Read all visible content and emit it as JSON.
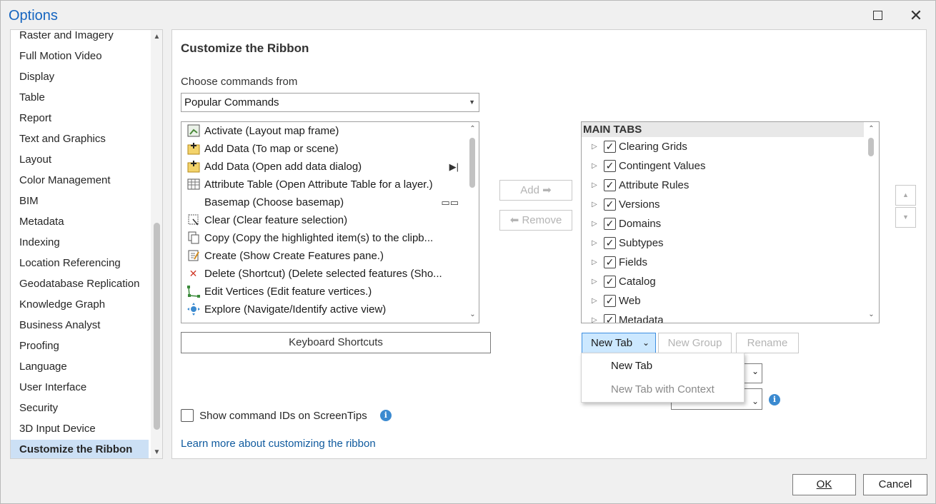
{
  "window": {
    "title": "Options"
  },
  "sidebar": {
    "items": [
      {
        "label": "Raster and Imagery"
      },
      {
        "label": "Full Motion Video"
      },
      {
        "label": "Display"
      },
      {
        "label": "Table"
      },
      {
        "label": "Report"
      },
      {
        "label": "Text and Graphics"
      },
      {
        "label": "Layout"
      },
      {
        "label": "Color Management"
      },
      {
        "label": "BIM"
      },
      {
        "label": "Metadata"
      },
      {
        "label": "Indexing"
      },
      {
        "label": "Location Referencing"
      },
      {
        "label": "Geodatabase Replication"
      },
      {
        "label": "Knowledge Graph"
      },
      {
        "label": "Business Analyst"
      },
      {
        "label": "Proofing"
      },
      {
        "label": "Language"
      },
      {
        "label": "User Interface"
      },
      {
        "label": "Security"
      },
      {
        "label": "3D Input Device"
      },
      {
        "label": "Customize the Ribbon"
      }
    ],
    "selected": "Customize the Ribbon"
  },
  "main": {
    "title": "Customize the Ribbon",
    "choose_label": "Choose commands from",
    "choose_value": "Popular Commands",
    "commands": [
      {
        "label": "Activate (Layout map frame)",
        "icon": "activate-icon"
      },
      {
        "label": "Add Data (To map or scene)",
        "icon": "add-data-icon"
      },
      {
        "label": "Add Data (Open add data dialog)",
        "icon": "add-data-icon",
        "right": "▶|"
      },
      {
        "label": "Attribute Table (Open Attribute Table for a layer.)",
        "icon": "table-icon"
      },
      {
        "label": "Basemap (Choose basemap)",
        "icon": "",
        "right": "▭▭"
      },
      {
        "label": "Clear (Clear feature selection)",
        "icon": "clear-icon"
      },
      {
        "label": "Copy (Copy the highlighted item(s) to the clipb...",
        "icon": "copy-icon"
      },
      {
        "label": "Create (Show Create Features pane.)",
        "icon": "create-icon"
      },
      {
        "label": "Delete (Shortcut) (Delete selected features (Sho...",
        "icon": "delete-icon"
      },
      {
        "label": "Edit Vertices (Edit feature vertices.)",
        "icon": "edit-vertices-icon"
      },
      {
        "label": "Explore (Navigate/Identify active view)",
        "icon": "explore-icon"
      }
    ],
    "keyboard_shortcuts": "Keyboard Shortcuts",
    "add_label": "Add",
    "remove_label": "Remove",
    "main_tabs_header": "MAIN TABS",
    "tabs": [
      {
        "label": "Clearing Grids",
        "checked": true
      },
      {
        "label": "Contingent Values",
        "checked": true
      },
      {
        "label": "Attribute Rules",
        "checked": true
      },
      {
        "label": "Versions",
        "checked": true
      },
      {
        "label": "Domains",
        "checked": true
      },
      {
        "label": "Subtypes",
        "checked": true
      },
      {
        "label": "Fields",
        "checked": true
      },
      {
        "label": "Catalog",
        "checked": true
      },
      {
        "label": "Web",
        "checked": true
      },
      {
        "label": "Metadata",
        "checked": true
      }
    ],
    "new_tab": "New Tab",
    "new_group": "New Group",
    "rename": "Rename",
    "show_ids": "Show command IDs on ScreenTips",
    "learn_more": "Learn more about customizing the ribbon",
    "dropdown_menu": [
      {
        "label": "New Tab",
        "enabled": true
      },
      {
        "label": "New Tab with Context",
        "enabled": false
      }
    ]
  },
  "footer": {
    "ok": "OK",
    "cancel": "Cancel"
  },
  "colors": {
    "accent": "#1565c0",
    "selection": "#cce0f5",
    "link": "#0f5a9e"
  }
}
